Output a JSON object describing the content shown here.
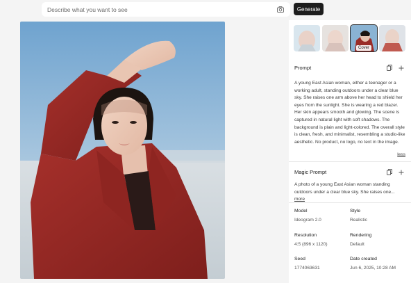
{
  "search": {
    "placeholder": "Describe what you want to see"
  },
  "toolbar": {
    "generate_label": "Generate"
  },
  "thumbnails": {
    "cover_label": "Cover"
  },
  "prompt": {
    "title": "Prompt",
    "text": "A young East Asian woman, either a teenager or a working adult, standing outdoors under a clear blue sky. She raises one arm above her head to shield her eyes from the sunlight. She is wearing a red blazer. Her skin appears smooth and glowing. The scene is captured in natural light with soft shadows. The background is plain and light-colored. The overall style is clean, fresh, and minimalist, resembling a studio-like aesthetic. No product, no logo, no text in the image.",
    "toggle_label": "less"
  },
  "magic_prompt": {
    "title": "Magic Prompt",
    "text": "A photo of a young East Asian woman standing outdoors under a clear blue sky. She raises one...",
    "toggle_label": "more"
  },
  "meta": {
    "model_label": "Model",
    "model_value": "Ideogram 2.0",
    "style_label": "Style",
    "style_value": "Realistic",
    "resolution_label": "Resolution",
    "resolution_value": "4:5 (896 x 1120)",
    "rendering_label": "Rendering",
    "rendering_value": "Default",
    "seed_label": "Seed",
    "seed_value": "1774063631",
    "date_label": "Date created",
    "date_value": "Jun 6, 2025, 10:28 AM"
  },
  "icons": [
    "camera-icon",
    "copy-icon",
    "plus-icon"
  ]
}
